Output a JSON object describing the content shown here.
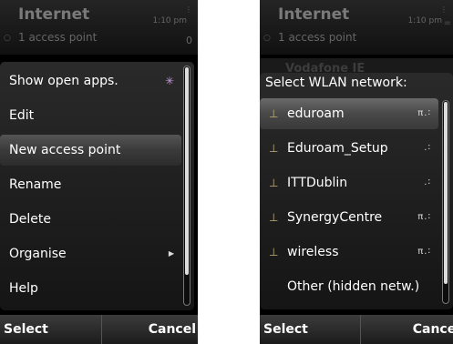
{
  "left_screen": {
    "status": {
      "title": "Internet",
      "subtitle": "1 access point",
      "time": "1:10 pm",
      "count": "0"
    },
    "menu": [
      {
        "label": "Show open apps.",
        "selected": false,
        "indicator": "ok-star-icon"
      },
      {
        "label": "Edit",
        "selected": false
      },
      {
        "label": "New access point",
        "selected": true
      },
      {
        "label": "Rename",
        "selected": false
      },
      {
        "label": "Delete",
        "selected": false
      },
      {
        "label": "Organise",
        "selected": false,
        "indicator": "submenu-arrow-icon"
      },
      {
        "label": "Help",
        "selected": false
      }
    ],
    "softkeys": {
      "left": "Select",
      "right": "Cancel"
    }
  },
  "right_screen": {
    "status": {
      "title": "Internet",
      "subtitle": "1 access point",
      "time": "1:10 pm"
    },
    "background_item": "Vodafone IE",
    "popup_title": "Select WLAN network:",
    "networks": [
      {
        "name": "eduroam",
        "selected": true,
        "secured": true
      },
      {
        "name": "Eduroam_Setup",
        "selected": false,
        "secured": false
      },
      {
        "name": "ITTDublin",
        "selected": false,
        "secured": false
      },
      {
        "name": "SynergyCentre",
        "selected": false,
        "secured": true
      },
      {
        "name": "wireless",
        "selected": false,
        "secured": true
      }
    ],
    "other_item": "Other (hidden netw.)",
    "softkeys": {
      "left": "Select",
      "right": "Cancel"
    }
  },
  "colors": {
    "selection": "#4a4a4a",
    "antenna": "#bfae7a",
    "background": "#000000"
  }
}
